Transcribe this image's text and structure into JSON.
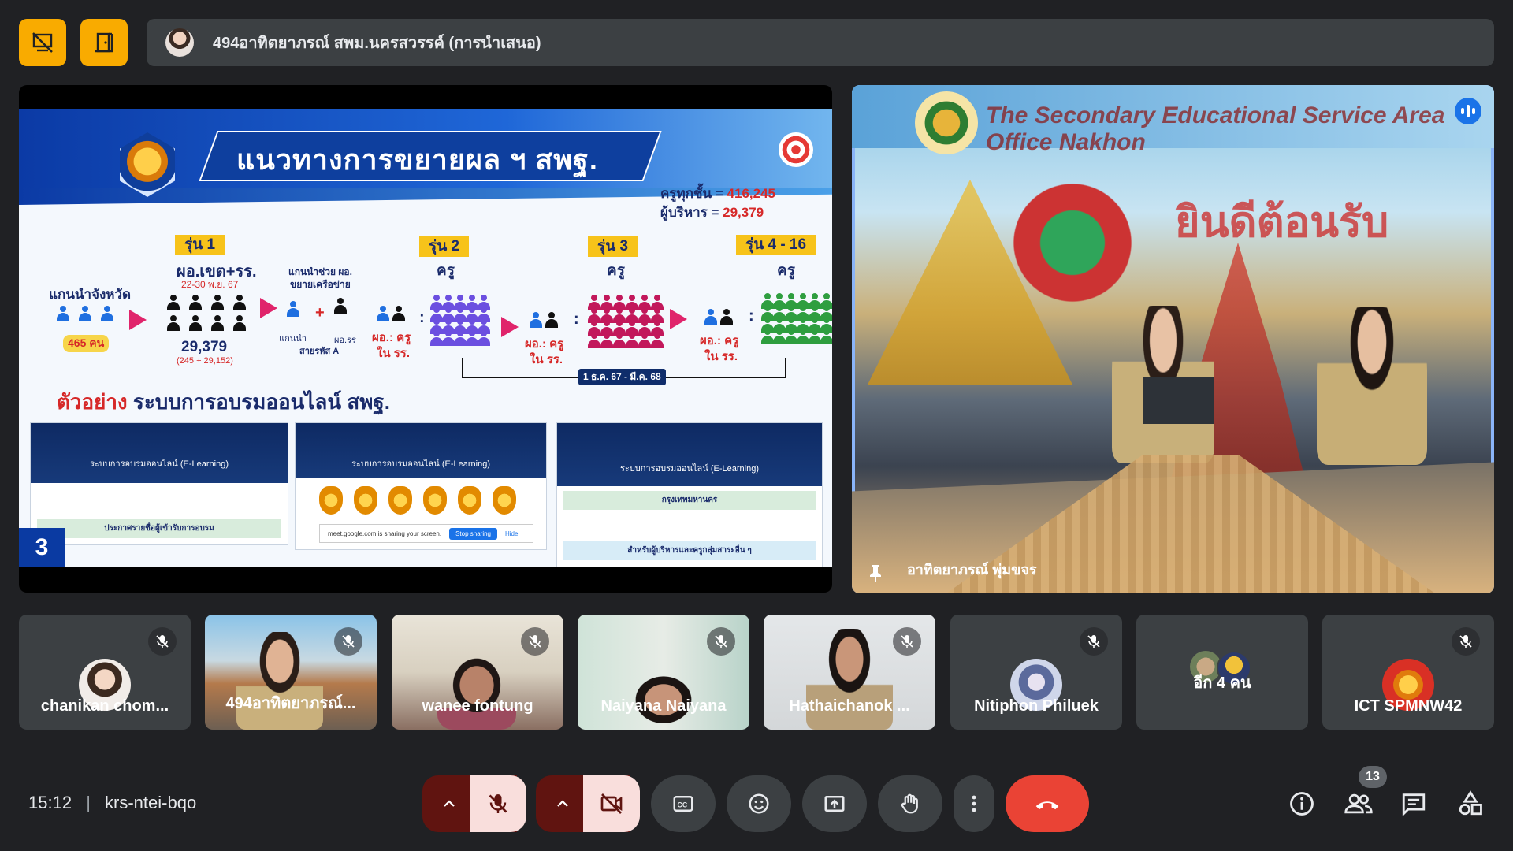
{
  "presenter_bar": {
    "title": "494อาทิตยาภรณ์ สพม.นครสวรรค์ (การนำเสนอ)"
  },
  "slide": {
    "title": "แนวทางการขยายผล ฯ สพฐ.",
    "teachers_label": "ครูทุกชั้น = ",
    "teachers_value": "416,245",
    "admins_label": "ผู้บริหาร = ",
    "admins_value": "29,379",
    "province_lead": "แกนนำจังหวัด",
    "province_count": "465 คน",
    "batch1": "รุ่น 1",
    "batch1_group": "ผอ.เขต+รร.",
    "batch1_date": "22-30 พ.ย. 67",
    "batch1_total": "29,379",
    "batch1_breakdown": "(245 + 29,152)",
    "assist_lead": "แกนนำช่วย ผอ.",
    "assist_lead2": "ขยายเครือข่าย",
    "lead_short": "แกนนำ",
    "network_a": "สายรหัส A",
    "school_dir": "ผอ.รร",
    "batch2": "รุ่น 2",
    "batch3": "รุ่น 3",
    "batch4": "รุ่น 4 - 16",
    "teacher": "ครู",
    "ratio_label": "ผอ.: ครู",
    "ratio_label2": "ใน รร.",
    "period": "1 ธ.ค. 67 - มี.ค. 68",
    "example_prefix": "ตัวอย่าง",
    "example_rest": "ระบบการอบรมออนไลน์ สพฐ.",
    "elearning": "ระบบการอบรมออนไลน์ (E-Learning)",
    "thumb1_bar": "ประกาศรายชื่อผู้เข้ารับการอบรม",
    "thumb2_share": "meet.google.com is sharing your screen.",
    "thumb2_stop": "Stop sharing",
    "thumb2_hide": "Hide",
    "thumb3_bar": "กรุงเทพมหานคร",
    "thumb3_bar2": "สำหรับผู้บริหารและครูกลุ่มสาระอื่น ๆ",
    "page_number": "3"
  },
  "main_video": {
    "name": "อาทิตยาภรณ์ พุ่มขจร",
    "banner_text": "The Secondary Educational Service Area Office Nakhon",
    "welcome_text": "ยินดีต้อนรับ"
  },
  "participants": [
    {
      "name": "chanikan chom..."
    },
    {
      "name": "494อาทิตยาภรณ์..."
    },
    {
      "name": "wanee fontung"
    },
    {
      "name": "Naiyana Naiyana"
    },
    {
      "name": "Hathaichanok ..."
    },
    {
      "name": "Nitiphon Philuek"
    },
    {
      "name": "อีก 4 คน"
    },
    {
      "name": "ICT SPMNW42"
    }
  ],
  "bottom_bar": {
    "time": "15:12",
    "meeting_code": "krs-ntei-bqo",
    "people_count": "13"
  },
  "colors": {
    "background": "#202124",
    "tile": "#3c4043",
    "accent_yellow": "#f9ab00",
    "end_call": "#ea4335",
    "active_speaker": "#8ab4f8"
  }
}
